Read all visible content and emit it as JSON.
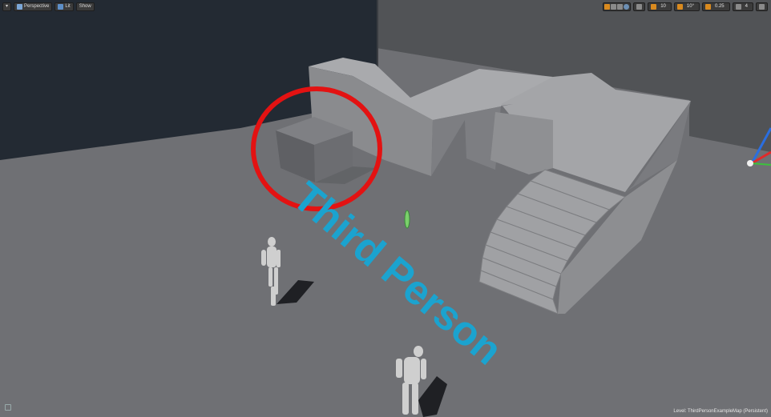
{
  "toolbar_left": {
    "menu_label": "▾",
    "perspective_label": "Perspective",
    "lit_label": "Lit",
    "show_label": "Show"
  },
  "toolbar_right": {
    "grid_snap_value": "10",
    "rotation_snap_value": "10°",
    "scale_snap_value": "0.25",
    "camera_speed_value": "4"
  },
  "scene": {
    "text_render_actor": "Third Person",
    "map_label": "Level:  ThirdPersonExampleMap (Persistent)"
  },
  "colors": {
    "floor": "#6f7074",
    "wall_dark": "#232a33",
    "wall_right": "#515356",
    "geometry": "#9d9ea1",
    "text_actor": "#1ba3cf",
    "annotation_circle": "#e31212",
    "toolbar_accent": "#d98a1e"
  },
  "icons": [
    "dropdown-arrow-icon",
    "camera-icon",
    "lit-sphere-icon",
    "select-icon",
    "move-icon",
    "rotate-icon",
    "scale-icon",
    "world-icon",
    "surface-snap-icon",
    "grid-icon",
    "angle-icon",
    "scale-snap-icon",
    "camera-speed-icon",
    "maximize-icon"
  ]
}
